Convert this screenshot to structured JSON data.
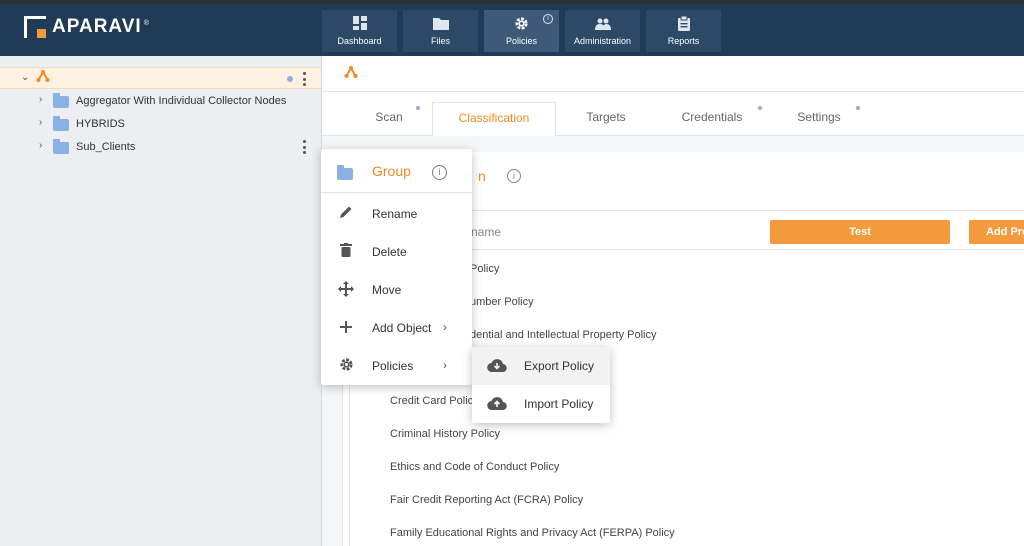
{
  "app": {
    "logo_text": "APARAVI",
    "logo_tm": "®"
  },
  "nav": [
    {
      "label": "Dashboard",
      "icon": "dashboard-icon"
    },
    {
      "label": "Files",
      "icon": "folder-icon"
    },
    {
      "label": "Policies",
      "icon": "gear-icon",
      "active": true,
      "info": "i"
    },
    {
      "label": "Administration",
      "icon": "users-icon"
    },
    {
      "label": "Reports",
      "icon": "clipboard-icon"
    }
  ],
  "sidebar": {
    "items": [
      {
        "label": "Aggregator With Individual Collector Nodes"
      },
      {
        "label": "HYBRIDS"
      },
      {
        "label": "Sub_Clients"
      }
    ]
  },
  "tabs": [
    "Scan",
    "Classification",
    "Targets",
    "Credentials",
    "Settings"
  ],
  "panel": {
    "title_fragment": "n",
    "info": "i",
    "column_header_fragment": "name",
    "test_button": "Test",
    "add_button_fragment": "Add Pre"
  },
  "policies": [
    "Policy",
    "umber Policy",
    "dential and Intellectual Property Policy",
    "Credit Card Polic",
    "Criminal History Policy",
    "Ethics and Code of Conduct Policy",
    "Fair Credit Reporting Act (FCRA) Policy",
    "Family Educational Rights and Privacy Act (FERPA) Policy"
  ],
  "context_menu": {
    "title": "Group",
    "info": "i",
    "items": [
      {
        "label": "Rename",
        "icon": "pencil-icon"
      },
      {
        "label": "Delete",
        "icon": "trash-icon"
      },
      {
        "label": "Move",
        "icon": "move-icon"
      },
      {
        "label": "Add Object",
        "icon": "plus-icon",
        "submenu": true
      },
      {
        "label": "Policies",
        "icon": "gear-icon",
        "submenu": true
      }
    ]
  },
  "sub_menu": {
    "items": [
      {
        "label": "Export Policy",
        "icon": "cloud-download-icon"
      },
      {
        "label": "Import Policy",
        "icon": "cloud-upload-icon"
      }
    ]
  },
  "colors": {
    "accent": "#f08a24",
    "header": "#1f3b55",
    "folder": "#8ab1e6",
    "button": "#f39a3c"
  }
}
